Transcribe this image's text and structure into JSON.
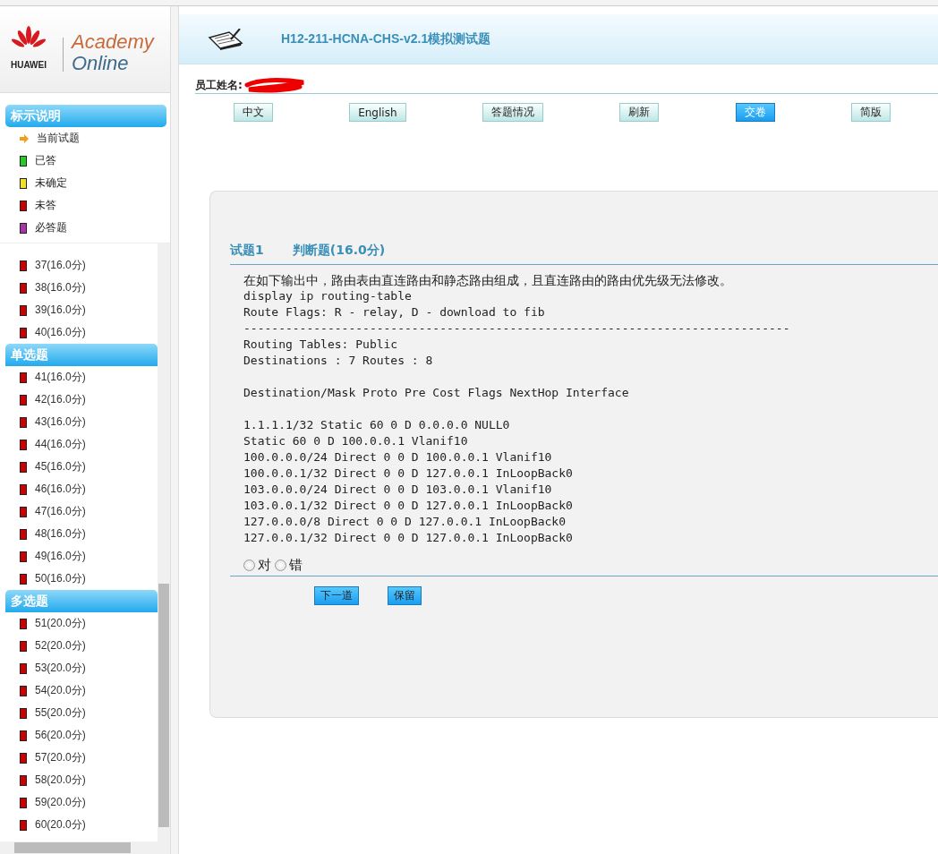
{
  "logo": {
    "brand": "HUAWEI",
    "line1": "Academy",
    "line2": "Online"
  },
  "legend": {
    "title": "标示说明",
    "items": [
      {
        "kind": "arrow",
        "label": "当前试题",
        "color": "#f0a020"
      },
      {
        "kind": "square",
        "label": "已答",
        "color": "#22cc22"
      },
      {
        "kind": "square",
        "label": "未确定",
        "color": "#f0e020"
      },
      {
        "kind": "square",
        "label": "未答",
        "color": "#cc0000"
      },
      {
        "kind": "square",
        "label": "必答题",
        "color": "#aa33aa"
      }
    ]
  },
  "question_groups": [
    {
      "items": [
        {
          "label": "37(16.0分)",
          "color": "#cc0000"
        },
        {
          "label": "38(16.0分)",
          "color": "#cc0000"
        },
        {
          "label": "39(16.0分)",
          "color": "#cc0000"
        },
        {
          "label": "40(16.0分)",
          "color": "#cc0000"
        }
      ]
    },
    {
      "title": "单选题",
      "items": [
        {
          "label": "41(16.0分)",
          "color": "#cc0000"
        },
        {
          "label": "42(16.0分)",
          "color": "#cc0000"
        },
        {
          "label": "43(16.0分)",
          "color": "#cc0000"
        },
        {
          "label": "44(16.0分)",
          "color": "#cc0000"
        },
        {
          "label": "45(16.0分)",
          "color": "#cc0000"
        },
        {
          "label": "46(16.0分)",
          "color": "#cc0000"
        },
        {
          "label": "47(16.0分)",
          "color": "#cc0000"
        },
        {
          "label": "48(16.0分)",
          "color": "#cc0000"
        },
        {
          "label": "49(16.0分)",
          "color": "#cc0000"
        },
        {
          "label": "50(16.0分)",
          "color": "#cc0000"
        }
      ]
    },
    {
      "title": "多选题",
      "items": [
        {
          "label": "51(20.0分)",
          "color": "#cc0000"
        },
        {
          "label": "52(20.0分)",
          "color": "#cc0000"
        },
        {
          "label": "53(20.0分)",
          "color": "#cc0000"
        },
        {
          "label": "54(20.0分)",
          "color": "#cc0000"
        },
        {
          "label": "55(20.0分)",
          "color": "#cc0000"
        },
        {
          "label": "56(20.0分)",
          "color": "#cc0000"
        },
        {
          "label": "57(20.0分)",
          "color": "#cc0000"
        },
        {
          "label": "58(20.0分)",
          "color": "#cc0000"
        },
        {
          "label": "59(20.0分)",
          "color": "#cc0000"
        },
        {
          "label": "60(20.0分)",
          "color": "#cc0000"
        }
      ]
    }
  ],
  "header": {
    "title": "H12-211-HCNA-CHS-v2.1模拟测试题"
  },
  "employee": {
    "label": "员工姓名:"
  },
  "toolbar": [
    {
      "label": "中文",
      "kind": "normal"
    },
    {
      "label": "English",
      "kind": "normal"
    },
    {
      "label": "答题情况",
      "kind": "normal"
    },
    {
      "label": "刷新",
      "kind": "normal"
    },
    {
      "label": "交卷",
      "kind": "primary"
    },
    {
      "label": "简版",
      "kind": "normal"
    }
  ],
  "question": {
    "number": "试题1",
    "type": "判断题(16.0分)",
    "blocks": [
      [
        "在如下输出中，路由表由直连路由和静态路由组成，且直连路由的路由优先级无法修改。",
        "display ip routing-table",
        "Route Flags: R - relay, D - download to fib",
        "------------------------------------------------------------------------------",
        "Routing Tables: Public",
        "Destinations : 7 Routes : 8"
      ],
      [
        "Destination/Mask Proto Pre Cost Flags NextHop Interface"
      ],
      [
        "1.1.1.1/32 Static 60 0 D 0.0.0.0 NULL0",
        "Static 60 0 D 100.0.0.1 Vlanif10",
        "100.0.0.0/24 Direct 0 0 D 100.0.0.1 Vlanif10",
        "100.0.0.1/32 Direct 0 0 D 127.0.0.1 InLoopBack0",
        "103.0.0.0/24 Direct 0 0 D 103.0.0.1 Vlanif10",
        "103.0.0.1/32 Direct 0 0 D 127.0.0.1 InLoopBack0",
        "127.0.0.0/8 Direct 0 0 D 127.0.0.1 InLoopBack0",
        "127.0.0.1/32 Direct 0 0 D 127.0.0.1 InLoopBack0"
      ]
    ],
    "options": [
      {
        "label": "对",
        "selected": false
      },
      {
        "label": "错",
        "selected": false
      }
    ],
    "buttons": [
      "下一道",
      "保留"
    ]
  }
}
